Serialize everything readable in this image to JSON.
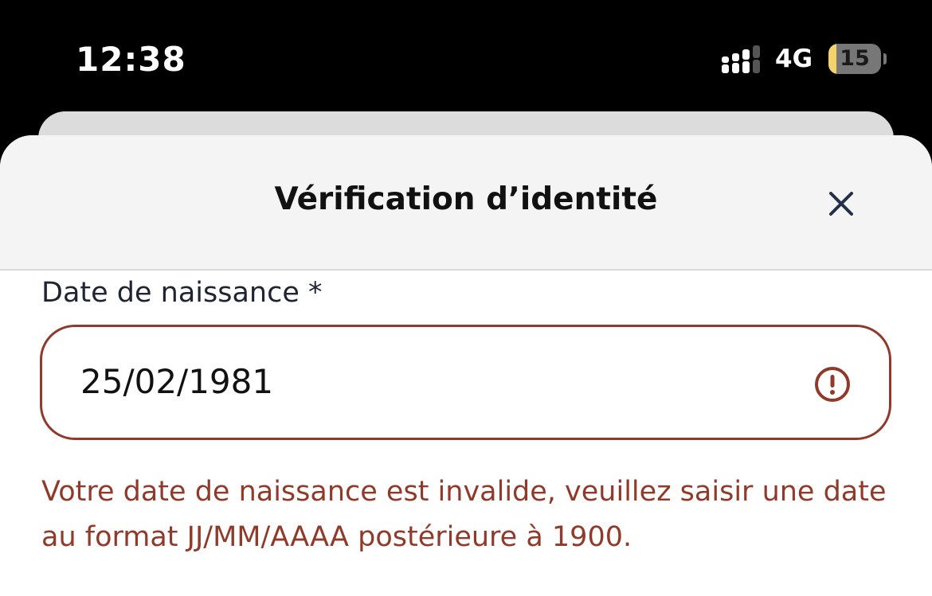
{
  "status_bar": {
    "time": "12:38",
    "network": "4G",
    "battery_level": "15",
    "signal_icon": "cellular-signal-icon",
    "battery_icon": "battery-icon"
  },
  "sheet": {
    "title": "Vérification d’identité",
    "close_icon": "close-icon"
  },
  "form": {
    "birth_date": {
      "label": "Date de naissance *",
      "value": "25/02/1981",
      "state_icon": "error-icon",
      "error_message": "Votre date de naissance est invalide, veuillez saisir une date au format JJ/MM/AAAA postérieure à 1900."
    }
  },
  "colors": {
    "error": "#8f3a2a",
    "header_background": "#f4f4f4",
    "battery_low": "#f3d36b"
  }
}
